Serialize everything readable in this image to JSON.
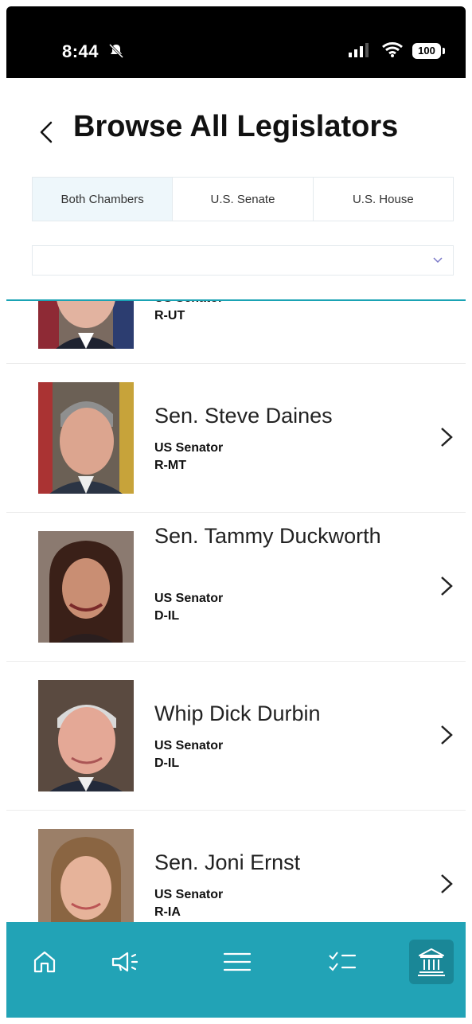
{
  "status_bar": {
    "time": "8:44",
    "battery": "100"
  },
  "header": {
    "title": "Browse All Legislators"
  },
  "tabs": [
    {
      "label": "Both Chambers",
      "active": true
    },
    {
      "label": "U.S. Senate",
      "active": false
    },
    {
      "label": "U.S. House",
      "active": false
    }
  ],
  "filter": {
    "value": ""
  },
  "legislators": [
    {
      "name": "",
      "role": "US Senator",
      "party": "R-UT"
    },
    {
      "name": "Sen. Steve Daines",
      "role": "US Senator",
      "party": "R-MT"
    },
    {
      "name": "Sen. Tammy Duckworth",
      "role": "US Senator",
      "party": "D-IL"
    },
    {
      "name": "Whip Dick Durbin",
      "role": "US Senator",
      "party": "D-IL"
    },
    {
      "name": "Sen. Joni Ernst",
      "role": "US Senator",
      "party": "R-IA"
    }
  ],
  "colors": {
    "accent": "#22a3b6",
    "nav_active": "#1a8797",
    "tab_active_bg": "#eef7fb"
  },
  "bottom_nav": [
    "home-icon",
    "megaphone-icon",
    "menu-icon",
    "checklist-icon",
    "capitol-icon"
  ]
}
